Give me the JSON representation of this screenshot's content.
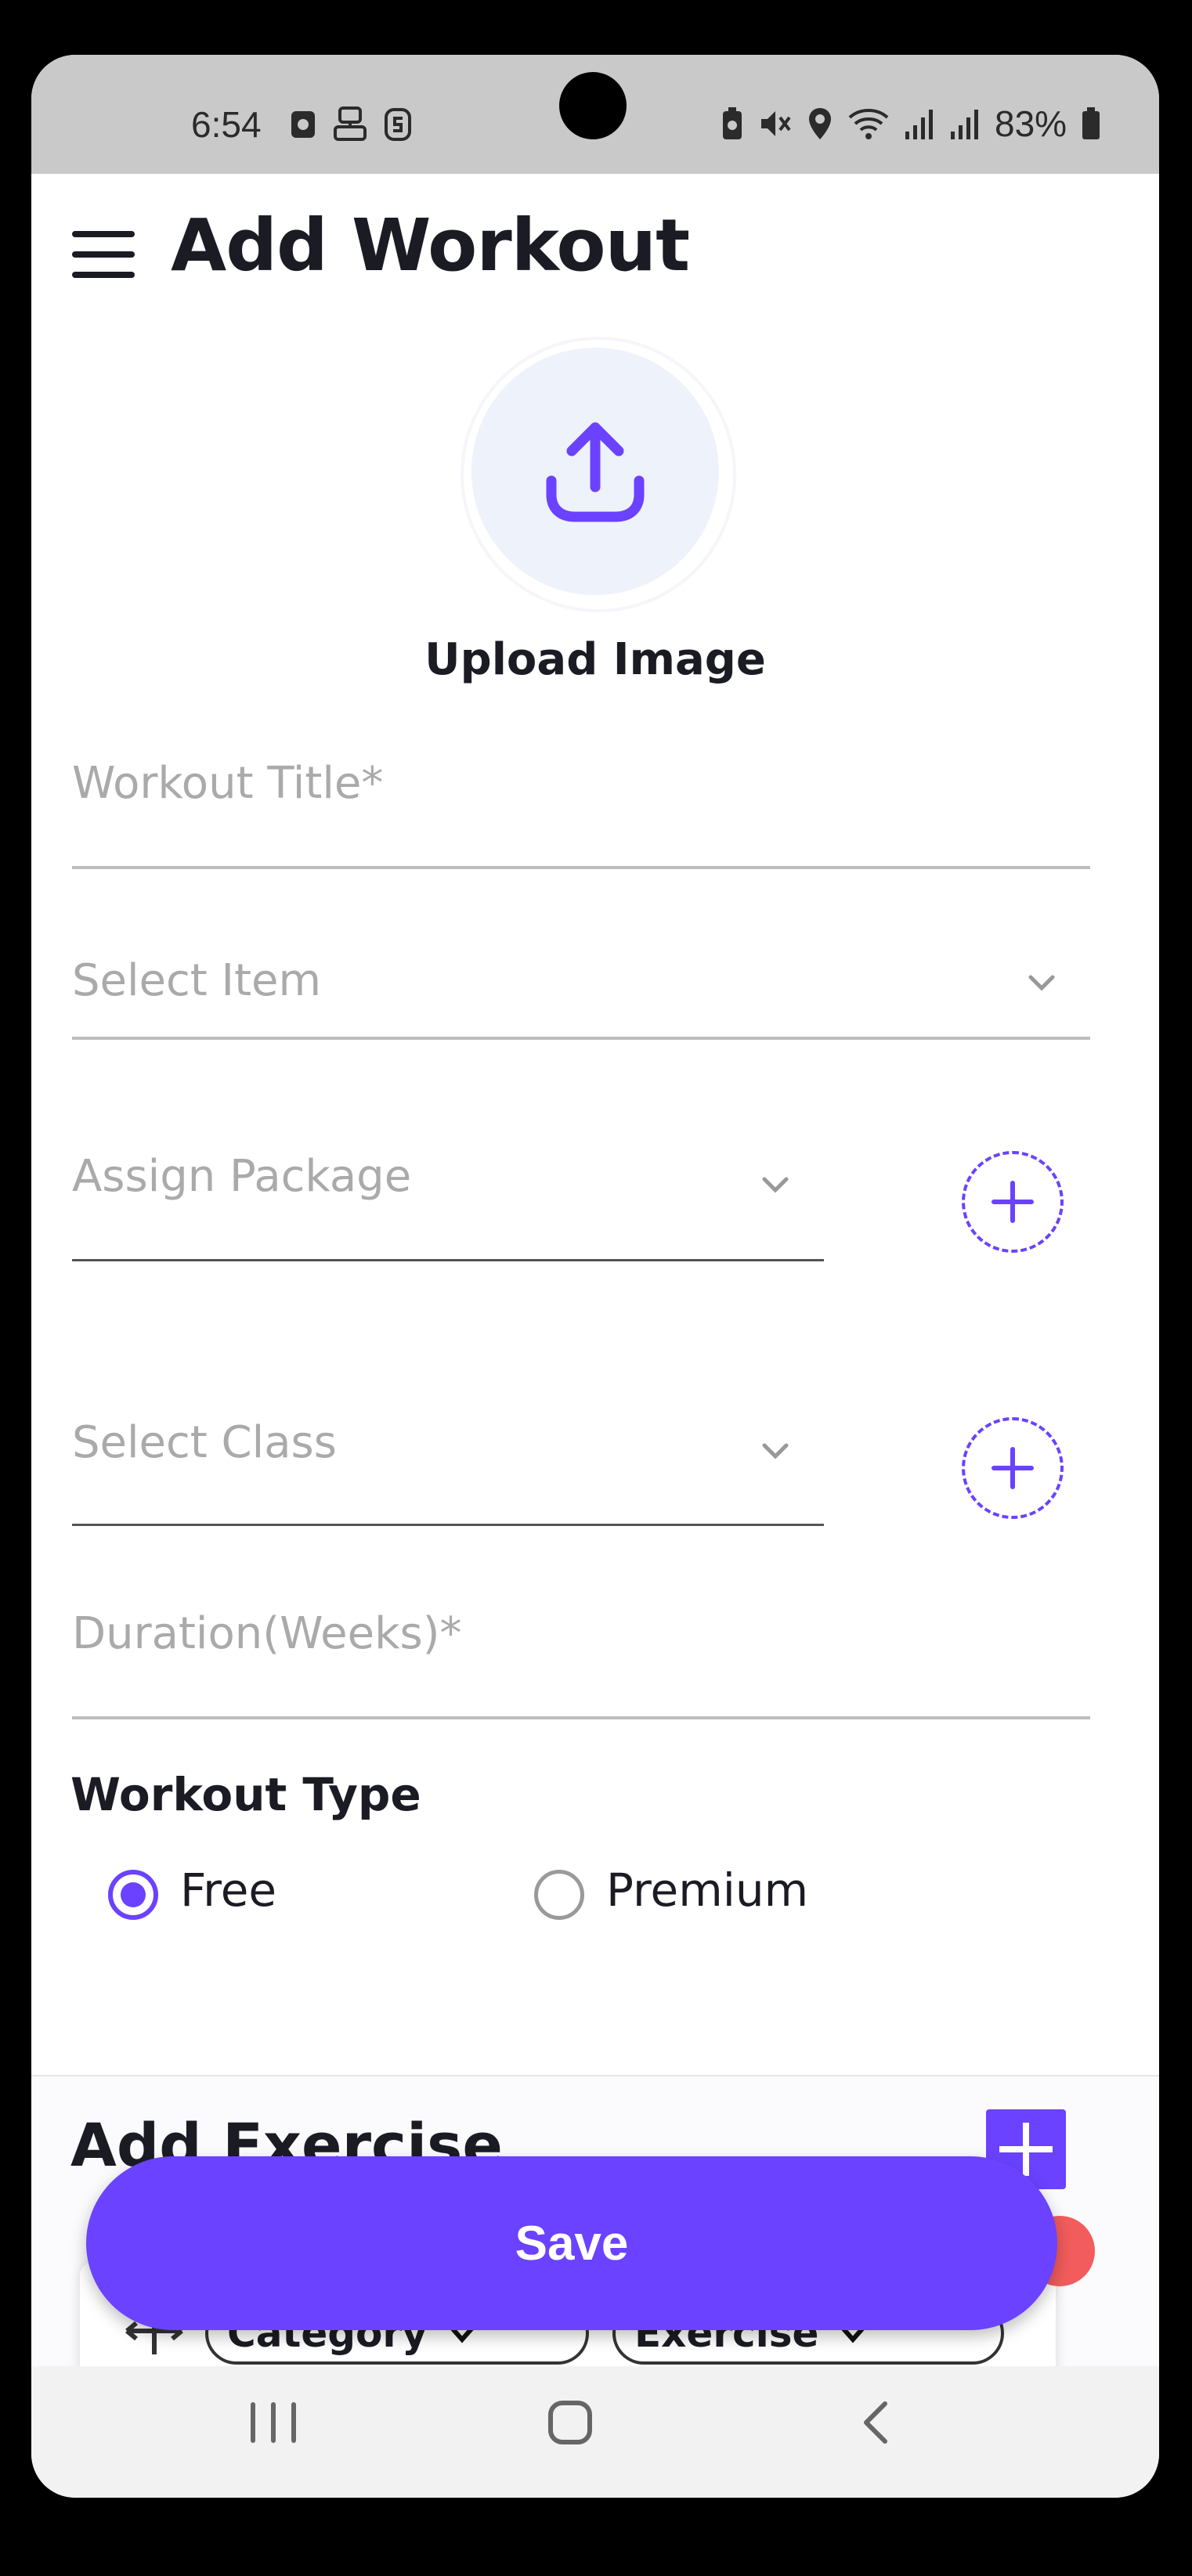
{
  "status_bar": {
    "time": "6:54",
    "battery": "83%",
    "left_icons": [
      "notification-icon",
      "robot-icon",
      "s-app-icon"
    ],
    "right_icons": [
      "battery-saver-icon",
      "mute-icon",
      "location-icon",
      "wifi-icon",
      "signal-icon",
      "signal-icon",
      "battery-icon"
    ]
  },
  "header": {
    "title": "Add Workout",
    "menu_icon": "hamburger-menu-icon"
  },
  "upload": {
    "label": "Upload Image",
    "icon": "upload-icon"
  },
  "form": {
    "workout_title_placeholder": "Workout Title*",
    "select_item_placeholder": "Select Item",
    "assign_package_placeholder": "Assign Package",
    "select_class_placeholder": "Select Class",
    "duration_placeholder": "Duration(Weeks)*",
    "workout_type": {
      "label": "Workout Type",
      "options": [
        {
          "label": "Free",
          "selected": true
        },
        {
          "label": "Premium",
          "selected": false
        }
      ]
    }
  },
  "exercise": {
    "title": "Add Exercise",
    "category_label": "Category",
    "exercise_label": "Exercise"
  },
  "actions": {
    "save_label": "Save"
  },
  "colors": {
    "accent": "#6a42ff",
    "danger": "#f25c5c",
    "placeholder": "#aaaaaa",
    "text": "#1b1b24"
  }
}
